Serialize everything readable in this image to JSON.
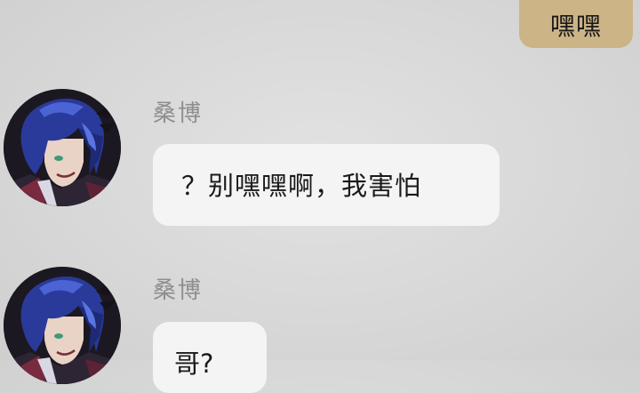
{
  "conversation": {
    "outgoing": [
      {
        "text": "嘿嘿"
      }
    ],
    "incoming": [
      {
        "sender": "桑博",
        "text": "？别嘿嘿啊，我害怕",
        "avatar_icon": "character-avatar"
      },
      {
        "sender": "桑博",
        "text": "哥?",
        "avatar_icon": "character-avatar"
      }
    ]
  },
  "colors": {
    "background": "#d9d9d9",
    "outgoing_bubble": "#ccb487",
    "incoming_bubble": "#f4f4f4",
    "sender_name": "#8e8e8e"
  }
}
